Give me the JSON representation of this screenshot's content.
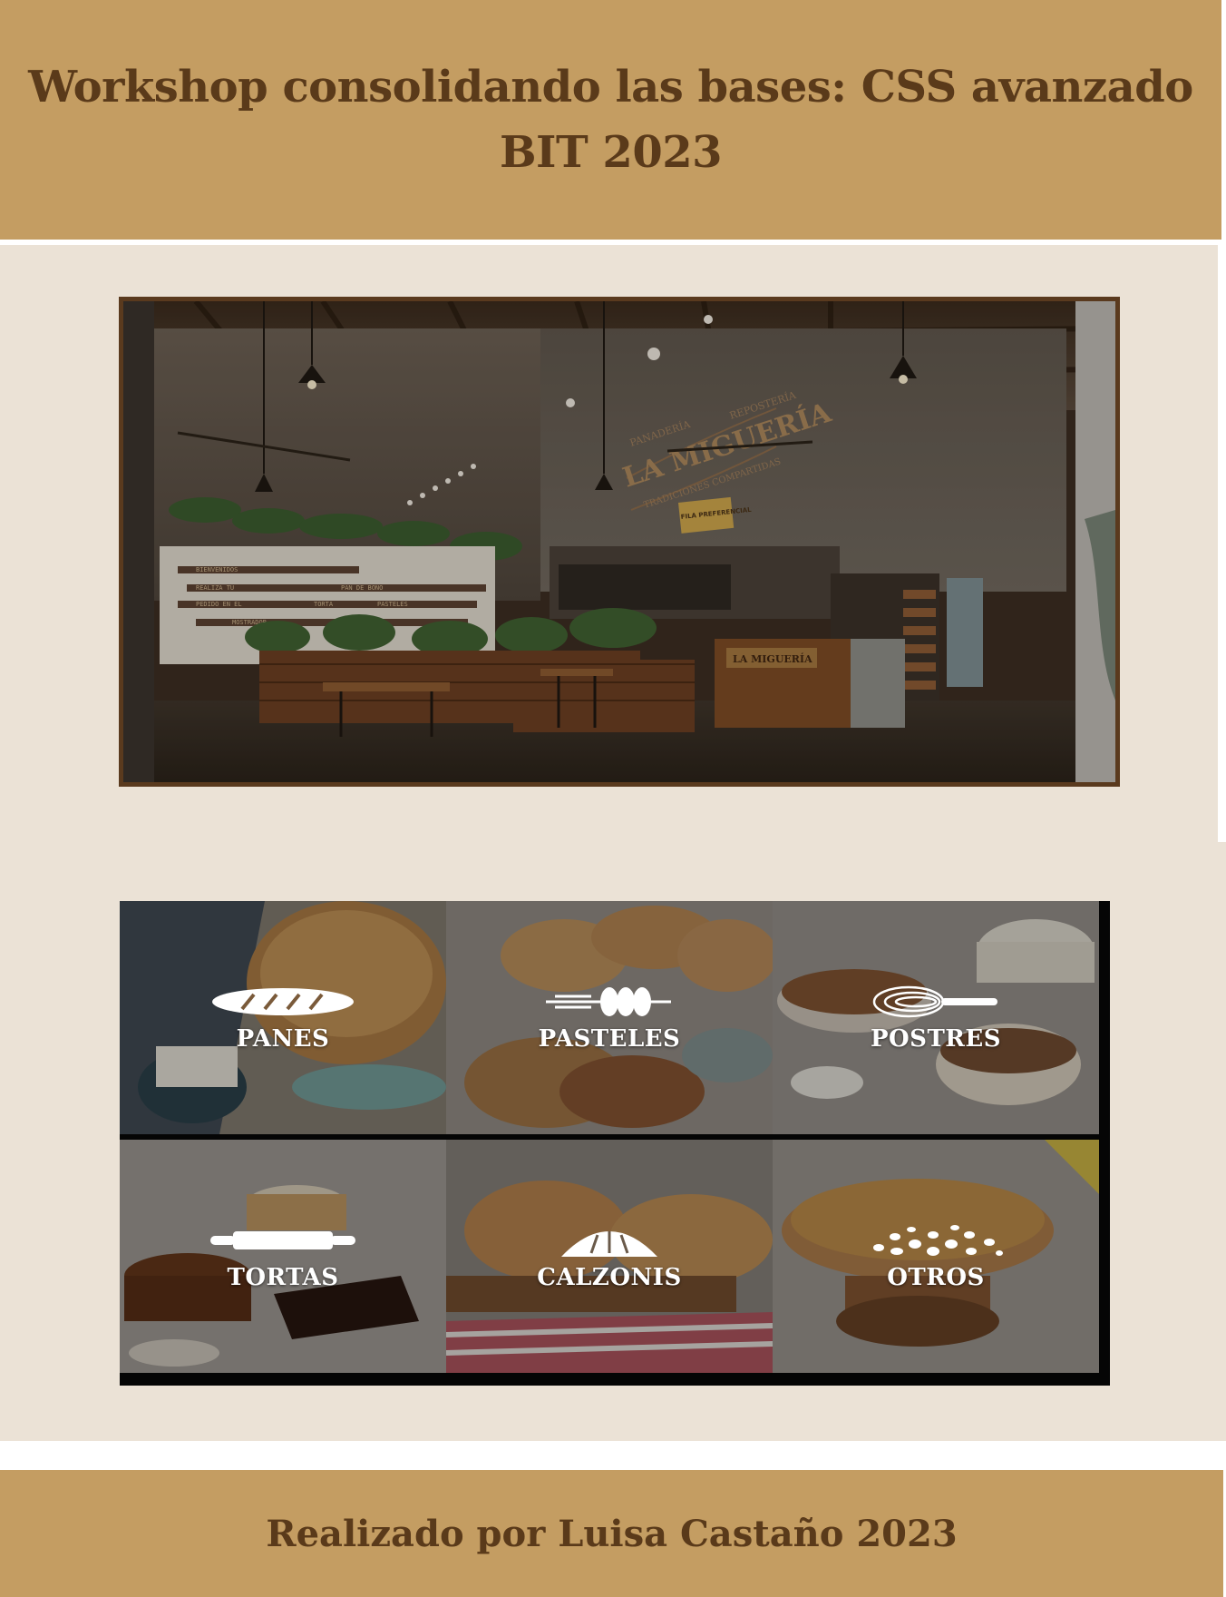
{
  "header": {
    "title_line1": "Workshop consolidando las bases: CSS avanzado",
    "title_line2": "BIT 2023"
  },
  "hero": {
    "sign_top_left": "PANADERÍA",
    "sign_top_right": "REPOSTERÍA",
    "sign_name": "LA MIGUERÍA",
    "sign_tagline": "TRADICIONES COMPARTIDAS",
    "fila_sign": "FILA PREFERENCIAL",
    "counter_sign": "LA MIGUERÍA",
    "wall_words": [
      "BIENVENIDOS",
      "PAN DE BONO",
      "REALIZA TU",
      "PEDIDO EN EL",
      "PASTELES",
      "TORTA",
      "MOSTRADOR"
    ]
  },
  "categories": [
    {
      "label": "PANES",
      "icon": "bread-icon",
      "color": "#8a6a4a"
    },
    {
      "label": "PASTELES",
      "icon": "wheat-icon",
      "color": "#7a6650"
    },
    {
      "label": "POSTRES",
      "icon": "whisk-icon",
      "color": "#8a7868"
    },
    {
      "label": "TORTAS",
      "icon": "rolling-pin-icon",
      "color": "#7a6a5c"
    },
    {
      "label": "CALZONIS",
      "icon": "empanada-icon",
      "color": "#6a5a4a"
    },
    {
      "label": "OTROS",
      "icon": "grains-icon",
      "color": "#7a6a5a"
    }
  ],
  "footer": {
    "credit": "Realizado por Luisa Castaño 2023"
  }
}
